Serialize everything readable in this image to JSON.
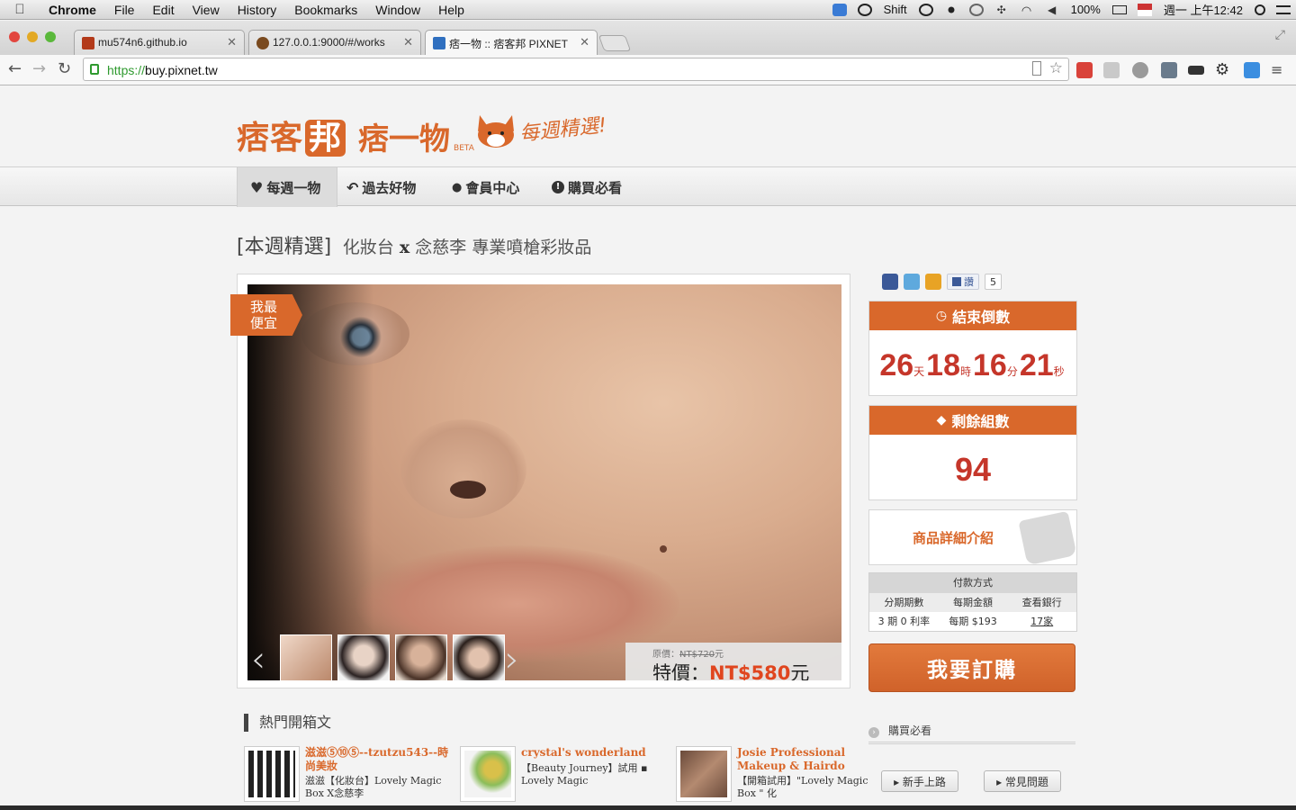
{
  "menubar": {
    "app": "Chrome",
    "items": [
      "File",
      "Edit",
      "View",
      "History",
      "Bookmarks",
      "Window",
      "Help"
    ],
    "shift_label": "Shift",
    "battery": "100%",
    "clock": "週一 上午12:42"
  },
  "tabs": [
    {
      "title": "mu574n6.github.io",
      "color": "#b33a1a"
    },
    {
      "title": "127.0.0.1:9000/#/works",
      "color": "#7a4a1f"
    },
    {
      "title": "痞一物 :: 痞客邦 PIXNET",
      "color": "#2f6fbf"
    }
  ],
  "address": {
    "scheme": "https://",
    "host": "buy.pixnet.tw"
  },
  "logo": {
    "brand": "痞客",
    "brand_box": "邦",
    "product": "痞一物",
    "beta": "BETA",
    "weekly": "每週精選!"
  },
  "nav": [
    {
      "label": "每週一物",
      "icon": "heart-icon",
      "glyph": "♥"
    },
    {
      "label": "過去好物",
      "icon": "undo-icon",
      "glyph": "↶"
    },
    {
      "label": "會員中心",
      "icon": "user-icon",
      "glyph": "👤"
    },
    {
      "label": "購買必看",
      "icon": "info-icon",
      "glyph": "❗"
    }
  ],
  "headline": {
    "tag": "[本週精選]",
    "title_a": "化妝台",
    "title_x": "x",
    "title_b": "念慈李 專業噴槍彩妝品"
  },
  "product": {
    "ribbon_line1": "我最",
    "ribbon_line2": "便宜",
    "original_label": "原價：",
    "original_price": "NT$720",
    "original_unit": "元",
    "special_label": "特價：",
    "special_price": "NT$580",
    "special_unit": "元"
  },
  "social": {
    "like_label": "讚",
    "like_count": "5"
  },
  "countdown": {
    "header": "結束倒數",
    "days": "26",
    "days_unit": "天",
    "hours": "18",
    "hours_unit": "時",
    "minutes": "16",
    "minutes_unit": "分",
    "seconds": "21",
    "seconds_unit": "秒"
  },
  "remaining": {
    "header": "剩餘組數",
    "value": "94"
  },
  "detail": {
    "label": "商品詳細介紹"
  },
  "payment": {
    "caption": "付款方式",
    "headers": [
      "分期期數",
      "每期金額",
      "查看銀行"
    ],
    "row": [
      "3 期 0 利率",
      "每期 $193",
      "17家"
    ]
  },
  "buy_button": "我要訂購",
  "hot": {
    "title": "熱門開箱文",
    "posts": [
      {
        "author": "滋滋⑤⑩⑤--tzutzu543--時尚美妝",
        "snippet": "滋滋【化妝台】Lovely Magic Box X念慈李"
      },
      {
        "author": "crystal's wonderland",
        "snippet": "【Beauty Journey】試用 ▪ Lovely Magic"
      },
      {
        "author": "Josie Professional Makeup & Hairdo",
        "snippet": "【開箱試用】\"Lovely Magic Box \" 化"
      }
    ]
  },
  "guide": {
    "title": "購買必看",
    "btn1": "▸ 新手上路",
    "btn2": "▸ 常見問題"
  },
  "colors": {
    "accent": "#d9682b",
    "price_red": "#e0461f",
    "count_red": "#c5362a"
  }
}
